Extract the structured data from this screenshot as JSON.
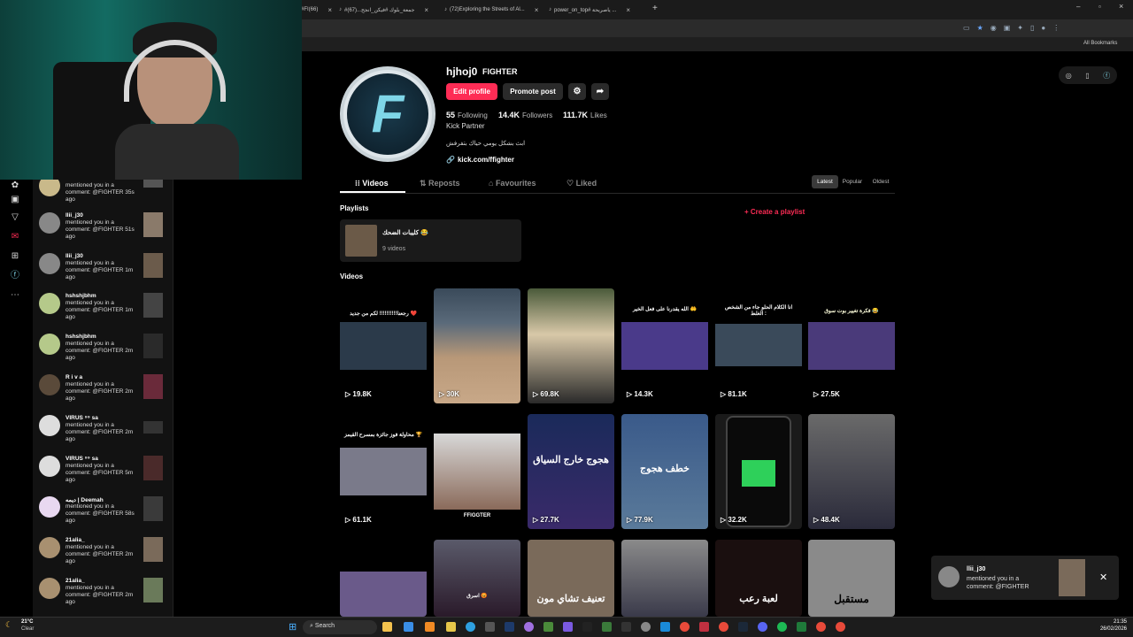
{
  "browser": {
    "tabs": [
      {
        "label": "#FI(66)"
      },
      {
        "label": "#جمعة_بلوك #فيكن_انجح...(67)"
      },
      {
        "label": "(72)Exploring the Streets of Al..."
      },
      {
        "label": "power_on_top# ياصريحة ..."
      }
    ],
    "bookmarks_label": "All Bookmarks"
  },
  "profile": {
    "username": "hjhoj0",
    "display_name": "FIGHTER",
    "edit_label": "Edit profile",
    "promote_label": "Promote post",
    "following_count": "55",
    "following_label": "Following",
    "followers_count": "14.4K",
    "followers_label": "Followers",
    "likes_count": "111.7K",
    "likes_label": "Likes",
    "partner": "Kick Partner",
    "bio": "ابث بشكل يومي حياك بتفرفش",
    "link": "kick.com/ffighter"
  },
  "tabs": {
    "videos": "Videos",
    "reposts": "Reposts",
    "favourites": "Favourites",
    "liked": "Liked"
  },
  "sort": {
    "latest": "Latest",
    "popular": "Popular",
    "oldest": "Oldest"
  },
  "playlists": {
    "heading": "Playlists",
    "create_label": "Create a playlist",
    "item_title": "كليبات الضحك 😂",
    "item_count": "9 videos"
  },
  "videos_heading": "Videos",
  "videos": [
    {
      "views": "19.8K",
      "caption": "رجعنا!!!!!!!!!! لكم من جديد ❤️"
    },
    {
      "views": "30K",
      "caption": ""
    },
    {
      "views": "69.8K",
      "caption": ""
    },
    {
      "views": "14.3K",
      "caption": "الله يقدرنا على فعل الخير 🤲"
    },
    {
      "views": "81.1K",
      "caption": "انا الكلام الحلو جاء من الشخص الغلط :"
    },
    {
      "views": "27.5K",
      "caption": "فكرة تغيير بوت سوق 😂"
    },
    {
      "views": "61.1K",
      "caption": "محاولة فوز جائزة بمسرح القيمز 🏆"
    },
    {
      "views": "",
      "caption": "FFIGGTER"
    },
    {
      "views": "27.7K",
      "caption": "هجوج خارج السياق"
    },
    {
      "views": "77.9K",
      "caption": "خطف هجوج"
    },
    {
      "views": "32.2K",
      "caption": ""
    },
    {
      "views": "48.4K",
      "caption": ""
    },
    {
      "views": "",
      "caption": ""
    },
    {
      "views": "",
      "caption": "اسرق 😡"
    },
    {
      "views": "",
      "caption": "تعنيف تشاي مون"
    },
    {
      "views": "",
      "caption": ""
    },
    {
      "views": "",
      "caption": "لعبة رعب"
    },
    {
      "views": "",
      "caption": "مستقبل"
    }
  ],
  "notifications": [
    {
      "name": "",
      "text": "mentioned you in a comment: @FIGHTER 35s ago"
    },
    {
      "name": "llii_j30",
      "text": "mentioned you in a comment: @FIGHTER 51s ago"
    },
    {
      "name": "llii_j30",
      "text": "mentioned you in a comment: @FIGHTER 1m ago"
    },
    {
      "name": "hshshjbhm",
      "text": "mentioned you in a comment: @FIGHTER 1m ago"
    },
    {
      "name": "hshshjbhm",
      "text": "mentioned you in a comment: @FIGHTER 2m ago"
    },
    {
      "name": "R i v a",
      "text": "mentioned you in a comment: @FIGHTER 2m ago"
    },
    {
      "name": "VIRUS ⁹⁹ sa",
      "text": "mentioned you in a comment: @FIGHTER 2m ago"
    },
    {
      "name": "VIRUS ⁹⁹ sa",
      "text": "mentioned you in a comment: @FIGHTER 5m ago"
    },
    {
      "name": "ديمه | Deemah",
      "text": "mentioned you in a comment: @FIGHTER 58s ago"
    },
    {
      "name": "21alia_",
      "text": "mentioned you in a comment: @FIGHTER 2m ago"
    },
    {
      "name": "21alia_",
      "text": "mentioned you in a comment: @FIGHTER 2m ago"
    }
  ],
  "toast": {
    "name": "llii_j30",
    "text": "mentioned you in a comment: @FIGHTER"
  },
  "taskbar": {
    "weather_temp": "21°C",
    "weather_desc": "Clear",
    "search_label": "Search",
    "time": "21:35",
    "date": "26/02/2026"
  },
  "colors": {
    "accent": "#fe2c55",
    "background": "#000000"
  }
}
